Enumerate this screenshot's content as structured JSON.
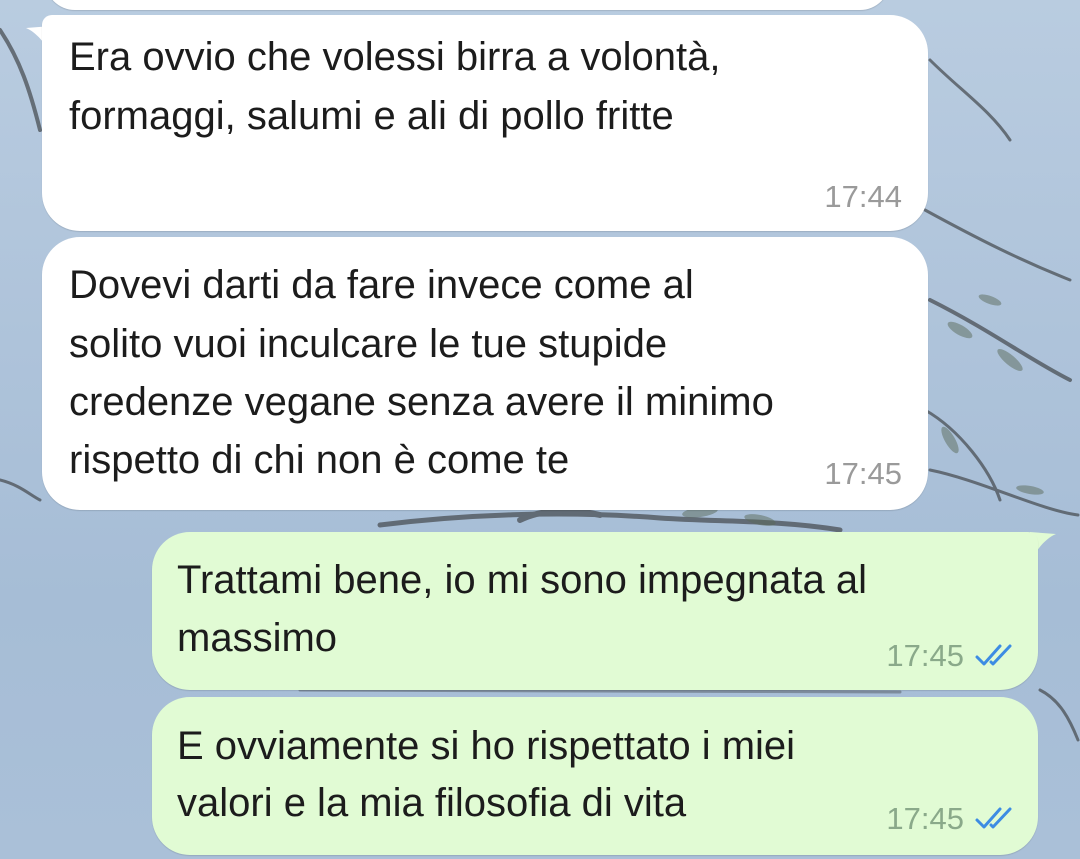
{
  "colors": {
    "incoming_bubble": "#ffffff",
    "outgoing_bubble": "#e1fbd4",
    "read_ticks": "#3d8ce3",
    "time_text": "#9a9a9a"
  },
  "messages": [
    {
      "direction": "incoming",
      "lines": [
        "Era ovvio che volessi birra a volontà,",
        "formaggi, salumi e ali di pollo fritte"
      ],
      "time": "17:44"
    },
    {
      "direction": "incoming",
      "lines": [
        "Dovevi darti da fare invece come al",
        "solito vuoi inculcare le tue stupide",
        "credenze vegane senza avere il minimo",
        "rispetto di chi non è come te"
      ],
      "time": "17:45"
    },
    {
      "direction": "outgoing",
      "lines": [
        "Trattami bene, io mi sono impegnata al",
        "massimo"
      ],
      "time": "17:45",
      "status_icon": "double-check-read-icon"
    },
    {
      "direction": "outgoing",
      "lines": [
        "E ovviamente si ho rispettato i miei",
        "valori e la mia filosofia di vita"
      ],
      "time": "17:45",
      "status_icon": "double-check-read-icon"
    }
  ]
}
